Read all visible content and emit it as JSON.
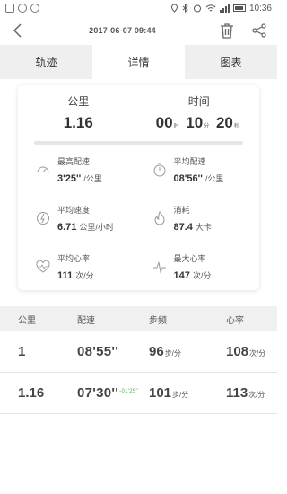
{
  "status": {
    "time": "10:36"
  },
  "header": {
    "title": "2017-06-07 09:44"
  },
  "tabs": [
    {
      "label": "轨迹"
    },
    {
      "label": "详情",
      "active": true
    },
    {
      "label": "图表"
    }
  ],
  "summary": {
    "distance_label": "公里",
    "distance_value": "1.16",
    "time_label": "时间",
    "time": {
      "hours": "00",
      "hours_unit": "时",
      "minutes": "10",
      "minutes_unit": "分",
      "seconds": "20",
      "seconds_unit": "秒"
    }
  },
  "stats": [
    {
      "label": "最高配速",
      "value": "3'25''",
      "unit": "/公里",
      "icon": "speedometer-icon"
    },
    {
      "label": "平均配速",
      "value": "08'56''",
      "unit": "/公里",
      "icon": "stopwatch-icon"
    },
    {
      "label": "平均速度",
      "value": "6.71",
      "unit": "公里/小时",
      "icon": "lightning-icon"
    },
    {
      "label": "消耗",
      "value": "87.4",
      "unit": "大卡",
      "icon": "flame-icon"
    },
    {
      "label": "平均心率",
      "value": "111",
      "unit": "次/分",
      "icon": "heart-pulse-icon"
    },
    {
      "label": "最大心率",
      "value": "147",
      "unit": "次/分",
      "icon": "pulse-icon"
    }
  ],
  "table": {
    "headers": [
      "公里",
      "配速",
      "步频",
      "心率"
    ],
    "rows": [
      {
        "km": "1",
        "pace": "08'55''",
        "pace_diff": "",
        "cadence": "96",
        "cadence_unit": "步/分",
        "hr": "108",
        "hr_unit": "次/分"
      },
      {
        "km": "1.16",
        "pace": "07'30''",
        "pace_diff": "-01'25''",
        "cadence": "101",
        "cadence_unit": "步/分",
        "hr": "113",
        "hr_unit": "次/分"
      }
    ]
  },
  "colors": {
    "accent_green": "#4caf50",
    "tab_bg": "#efefef"
  }
}
